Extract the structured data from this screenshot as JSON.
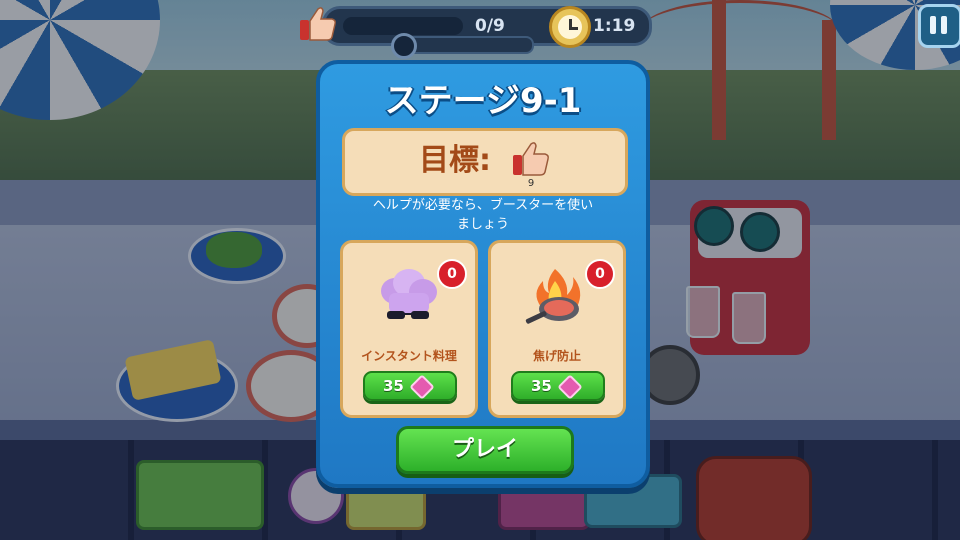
{
  "hud": {
    "goal_progress": "0/9",
    "goal_fraction": 0,
    "timer": "1:19",
    "icons": {
      "goal": "thumbs-up-icon",
      "timer": "stopwatch-icon",
      "pause": "pause-icon"
    }
  },
  "dialog": {
    "title": "ステージ9-1",
    "goal": {
      "label": "目標:",
      "icon": "thumbs-up-icon",
      "count": "9"
    },
    "help_text_line1": "ヘルプが必要なら、ブースターを使い",
    "help_text_line2": "ましょう",
    "boosters": [
      {
        "name": "インスタント料理",
        "icon": "chef-hat-sunglasses-icon",
        "owned": "0",
        "price": "35",
        "currency_icon": "gem-icon"
      },
      {
        "name": "焦げ防止",
        "icon": "flaming-pan-icon",
        "owned": "0",
        "price": "35",
        "currency_icon": "gem-icon"
      }
    ],
    "play_label": "プレイ"
  },
  "colors": {
    "dialog_blue": "#2f9be1",
    "panel_cream": "#f5ddb8",
    "button_green": "#3cc035",
    "badge_red": "#d8202b",
    "goal_text": "#a34a18"
  }
}
